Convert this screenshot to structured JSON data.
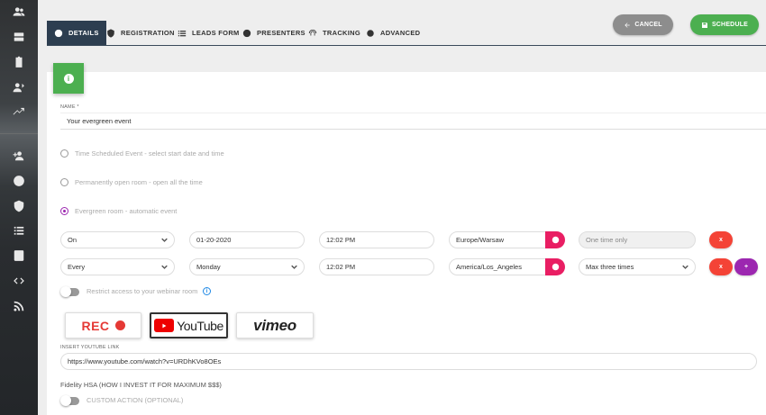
{
  "sidebar": {
    "icons": [
      "people-icon",
      "server-icon",
      "clipboard-icon",
      "user-presenter-icon",
      "trending-icon",
      "group-add-icon",
      "smile-icon",
      "shield-icon",
      "list-icon",
      "contact-icon",
      "code-icon",
      "rss-icon"
    ]
  },
  "tabs": [
    {
      "label": "DETAILS",
      "icon": "info-icon",
      "active": true
    },
    {
      "label": "REGISTRATION",
      "icon": "shield-icon"
    },
    {
      "label": "LEADS FORM",
      "icon": "list-icon"
    },
    {
      "label": "PRESENTERS",
      "icon": "smile-icon"
    },
    {
      "label": "TRACKING",
      "icon": "fingerprint-icon"
    },
    {
      "label": "ADVANCED",
      "icon": "gear-icon"
    }
  ],
  "actions": {
    "cancel_label": "CANCEL",
    "schedule_label": "SCHEDULE"
  },
  "form": {
    "name_label": "NAME *",
    "name_value": "Your evergreen event",
    "radios": [
      {
        "label": "Time Scheduled Event - select start date and time",
        "checked": false
      },
      {
        "label": "Permanently open room - open all the time",
        "checked": false
      },
      {
        "label": "Evergreen room - automatic event",
        "checked": true
      }
    ],
    "row1": {
      "mode": "On",
      "date": "01-20-2020",
      "time": "12:02 PM",
      "timezone": "Europe/Warsaw",
      "frequency": "One time only",
      "remove_label": "x"
    },
    "row2": {
      "mode": "Every",
      "day": "Monday",
      "time": "12:02 PM",
      "timezone": "America/Los_Angeles",
      "frequency": "Max three times",
      "remove_label": "x",
      "add_label": "+"
    },
    "restrict_label": "Restrict access to your webinar room",
    "sources": {
      "rec": "REC",
      "youtube": "YouTube",
      "vimeo": "vimeo",
      "selected": "youtube"
    },
    "youtube_label": "INSERT YOUTUBE LINK",
    "youtube_value": "https://www.youtube.com/watch?v=URDhKVo8OEs",
    "video_title": "Fidelity HSA (HOW I INVEST IT FOR MAXIMUM $$$)",
    "custom_action_label": "CUSTOM ACTION (OPTIONAL)"
  }
}
